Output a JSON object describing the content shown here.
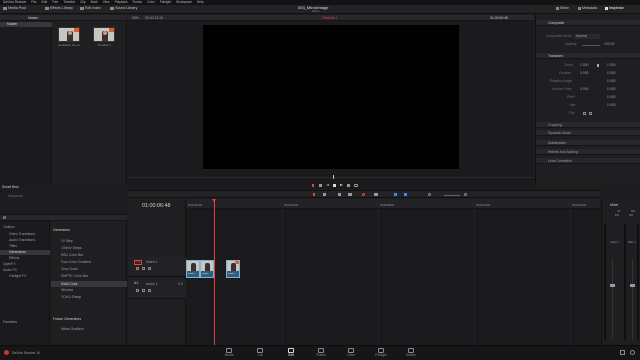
{
  "menubar": {
    "items": [
      "DaVinci Resolve",
      "File",
      "Edit",
      "Trim",
      "Timeline",
      "Clip",
      "Mark",
      "View",
      "Playback",
      "Fusion",
      "Color",
      "Fairlight",
      "Workspace",
      "Help"
    ]
  },
  "toolbar": {
    "media_pool": "Media Pool",
    "effects_library": "Effects Library",
    "edit_index": "Edit Index",
    "sound_library": "Sound Library",
    "project_title": "003_MirrorImage",
    "edited_badge": "Edited",
    "mixer": "Mixer",
    "metadata": "Metadata",
    "inspector": "Inspector"
  },
  "viewer": {
    "zoom": "39%",
    "source_timecode": "00:00:13;15",
    "timeline_name": "Timeline 1",
    "timecode": "01:00:06:48"
  },
  "media_pool": {
    "title": "Master",
    "bin": "Master",
    "clips": [
      {
        "name": "production 01_ve..."
      },
      {
        "name": "Timeline 1"
      }
    ]
  },
  "smart_bins": {
    "title": "Smart Bins",
    "item": "Keywords"
  },
  "effects": {
    "toolbox_tree": [
      "Toolbox",
      "Video Transitions",
      "Audio Transitions",
      "Titles",
      "Generators",
      "Effects",
      "OpenFX",
      "Audio FX",
      "Fairlight FX"
    ],
    "selected_tree": "Generators",
    "favorites": "Favorites",
    "generators_title": "Generators",
    "generators": [
      "10 Step",
      "100mV Steps",
      "EBU Color Bar",
      "Four Color Gradient",
      "Grey Scale",
      "SMPTE Color Bar",
      "Solid Color",
      "Window",
      "YCbCr Ramp"
    ],
    "selected_generator": "Solid Color",
    "fusion_generators_title": "Fusion Generators",
    "fusion_generators": [
      "Noise Gradient"
    ]
  },
  "inspector": {
    "composite_title": "Composite",
    "composite_mode_label": "Composite Mode",
    "composite_mode_value": "Normal",
    "opacity_label": "Opacity",
    "opacity_value": "100.00",
    "transform_title": "Transform",
    "rows": [
      {
        "label": "Zoom",
        "x": "1.000",
        "y": "1.000"
      },
      {
        "label": "Position",
        "x": "0.000",
        "y": "0.000"
      },
      {
        "label": "Rotation Angle",
        "x": "0.000",
        "y": ""
      },
      {
        "label": "Anchor Point",
        "x": "0.000",
        "y": "0.000"
      },
      {
        "label": "Pitch",
        "x": "0.000",
        "y": ""
      },
      {
        "label": "Yaw",
        "x": "0.000",
        "y": ""
      },
      {
        "label": "Flip",
        "x": "",
        "y": ""
      }
    ],
    "sections": [
      "Cropping",
      "Dynamic Zoom",
      "Stabilization",
      "Retime And Scaling",
      "Lens Correction"
    ]
  },
  "timeline": {
    "timecode": "01:00:06:48",
    "ruler_labels": [
      "01:00:00:00",
      "01:00:04:00",
      "01:00:08:00",
      "01:00:12:00",
      "01:00:16:00"
    ],
    "video_track_id": "V1",
    "video_track_name": "Video 1",
    "audio_track_id": "A1",
    "audio_track_name": "Audio 1",
    "audio_track_level": "2.0",
    "clip_labels": [
      "produ...",
      "produ...",
      "produ..."
    ]
  },
  "mixer": {
    "title": "Mixer",
    "a1": "A1",
    "m1": "M1",
    "a1_value": "0.0",
    "m1_value": "0.0",
    "audio1": "Audio 1",
    "main1": "Main 1"
  },
  "pages": [
    {
      "label": "Media"
    },
    {
      "label": "Cut"
    },
    {
      "label": "Edit"
    },
    {
      "label": "Fusion"
    },
    {
      "label": "Color"
    },
    {
      "label": "Fairlight"
    },
    {
      "label": "Deliver"
    }
  ],
  "active_page": "Edit",
  "app_name": "DaVinci Resolve 16",
  "colors": {
    "accent_red": "#e0443c",
    "clip_blue": "#2f5e7d",
    "playhead": "#e0443c"
  }
}
